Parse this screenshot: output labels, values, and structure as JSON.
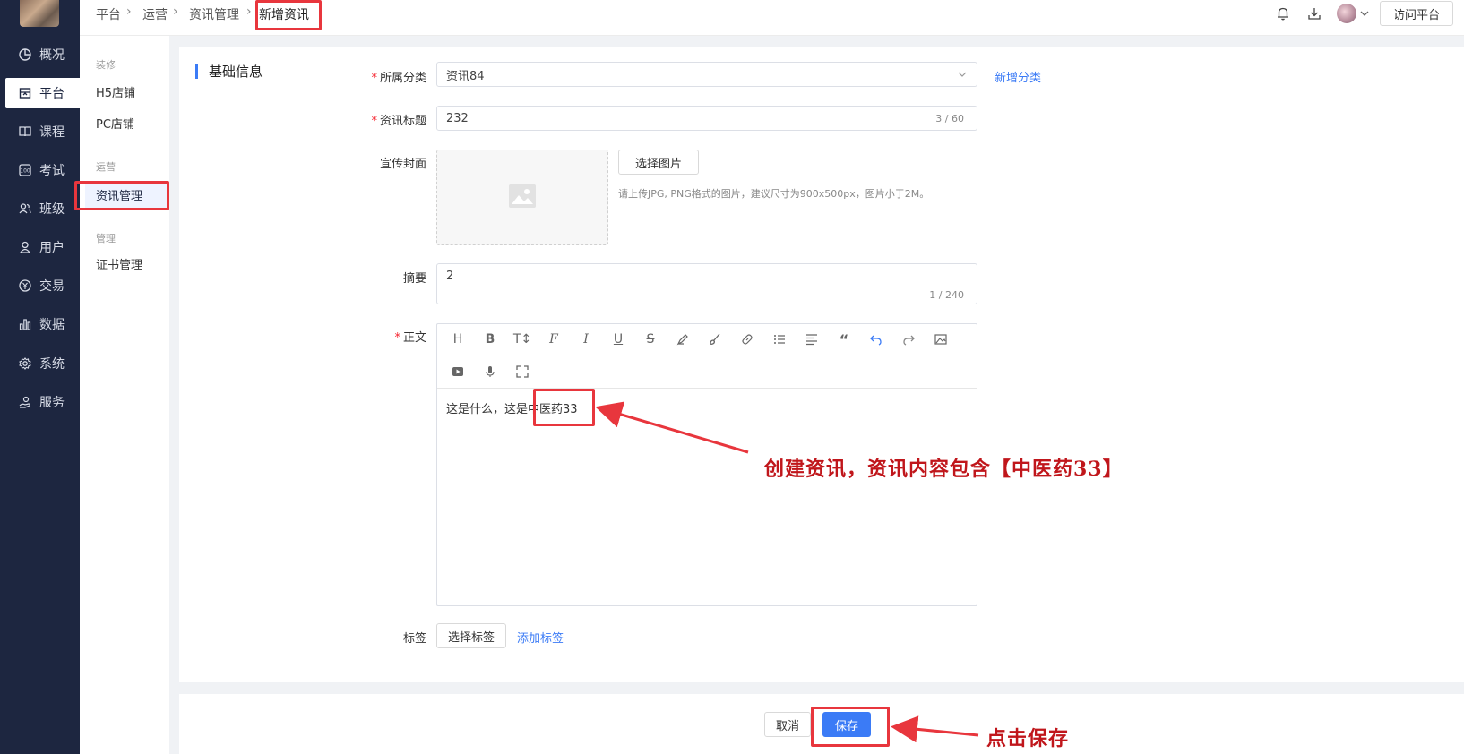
{
  "sidebar": {
    "items": [
      {
        "label": "概况",
        "icon": "pie-chart-icon"
      },
      {
        "label": "平台",
        "icon": "store-icon"
      },
      {
        "label": "课程",
        "icon": "book-icon"
      },
      {
        "label": "考试",
        "icon": "exam-icon"
      },
      {
        "label": "班级",
        "icon": "group-icon"
      },
      {
        "label": "用户",
        "icon": "user-icon"
      },
      {
        "label": "交易",
        "icon": "currency-icon"
      },
      {
        "label": "数据",
        "icon": "bar-chart-icon"
      },
      {
        "label": "系统",
        "icon": "gear-icon"
      },
      {
        "label": "服务",
        "icon": "service-icon"
      }
    ]
  },
  "submenu": {
    "group1": "装修",
    "item_h5": "H5店铺",
    "item_pc": "PC店铺",
    "group2": "运营",
    "item_news": "资讯管理",
    "group3": "管理",
    "item_cert": "证书管理"
  },
  "breadcrumb": {
    "items": [
      "平台",
      "运营",
      "资讯管理",
      "新增资讯"
    ]
  },
  "topbar": {
    "visit_label": "访问平台"
  },
  "form": {
    "section_title": "基础信息",
    "category_label": "所属分类",
    "category_value": "资讯84",
    "add_category": "新增分类",
    "title_label": "资讯标题",
    "title_value": "232",
    "title_counter": "3 / 60",
    "cover_label": "宣传封面",
    "choose_image": "选择图片",
    "cover_hint": "请上传JPG, PNG格式的图片，建议尺寸为900x500px，图片小于2M。",
    "summary_label": "摘要",
    "summary_value": "2",
    "summary_counter": "1 / 240",
    "body_label": "正文",
    "body_text": "这是什么，这是中医药33",
    "tags_label": "标签",
    "choose_tags": "选择标签",
    "add_tag": "添加标签"
  },
  "footer": {
    "cancel": "取消",
    "save": "保存"
  },
  "annotations": {
    "create_note": "创建资讯，资讯内容包含【中医药33】",
    "save_note": "点击保存"
  },
  "colors": {
    "sidebar_bg": "#1d2640",
    "accent": "#3b7bf6",
    "highlight": "#e8363d"
  }
}
